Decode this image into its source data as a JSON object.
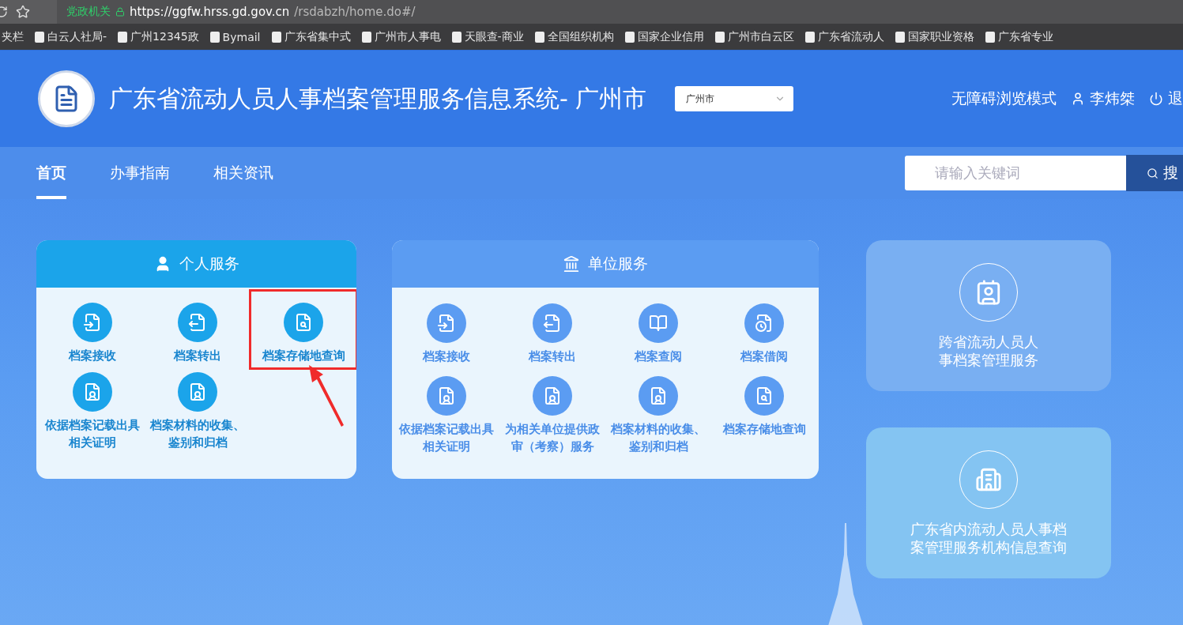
{
  "browser": {
    "badge": "党政机关",
    "url_host": "https://ggfw.hrss.gd.gov.cn",
    "url_path": "/rsdabzh/home.do#/",
    "bookmarks": [
      "夹栏",
      "白云人社局-",
      "广州12345政",
      "Bymail",
      "广东省集中式",
      "广州市人事电",
      "天眼查-商业",
      "全国组织机构",
      "国家企业信用",
      "广州市白云区",
      "广东省流动人",
      "国家职业资格",
      "广东省专业"
    ]
  },
  "header": {
    "title": "广东省流动人员人事档案管理服务信息系统- 广州市",
    "city_select": "广州市",
    "accessibility": "无障碍浏览模式",
    "user": "李炜桀",
    "logout": "退"
  },
  "nav": {
    "tabs": [
      {
        "label": "首页",
        "selected": true
      },
      {
        "label": "办事指南",
        "selected": false
      },
      {
        "label": "相关资讯",
        "selected": false
      }
    ],
    "search": {
      "placeholder": "请输入关键词",
      "button": "搜"
    }
  },
  "personal_services": {
    "title": "个人服务",
    "items": [
      {
        "label": "档案接收",
        "annotated": false
      },
      {
        "label": "档案转出",
        "annotated": false
      },
      {
        "label": "档案存储地查询",
        "annotated": true
      },
      {
        "label": "依据档案记载出具相关证明",
        "annotated": false
      },
      {
        "label": "档案材料的收集、鉴别和归档",
        "annotated": false
      }
    ]
  },
  "unit_services": {
    "title": "单位服务",
    "items": [
      {
        "label": "档案接收"
      },
      {
        "label": "档案转出"
      },
      {
        "label": "档案查阅"
      },
      {
        "label": "档案借阅"
      },
      {
        "label": "依据档案记载出具相关证明"
      },
      {
        "label": "为相关单位提供政审（考察）服务"
      },
      {
        "label": "档案材料的收集、鉴别和归档"
      },
      {
        "label": "档案存储地查询"
      }
    ]
  },
  "side_cards": [
    {
      "lines": [
        "跨省流动人员人",
        "事档案管理服务"
      ]
    },
    {
      "lines": [
        "广东省内流动人员人事档",
        "案管理服务机构信息查询"
      ]
    }
  ]
}
